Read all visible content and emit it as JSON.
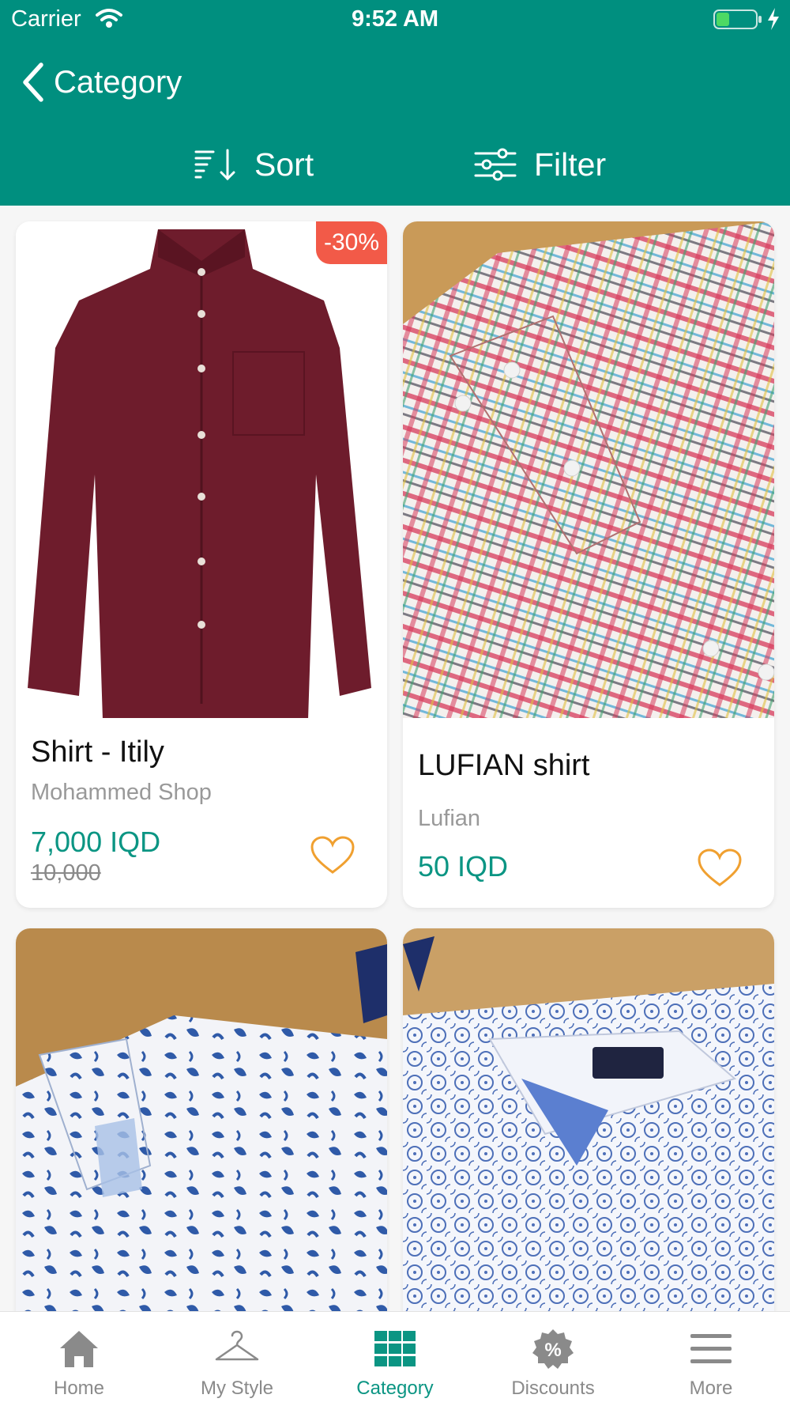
{
  "status_bar": {
    "carrier": "Carrier",
    "time": "9:52 AM"
  },
  "header": {
    "back_label": "Category",
    "sort_label": "Sort",
    "filter_label": "Filter"
  },
  "products": [
    {
      "title": "Shirt - Itily",
      "shop": "Mohammed Shop",
      "price": "7,000 IQD",
      "old_price": "10,000",
      "badge": "-30%"
    },
    {
      "title": "LUFIAN shirt",
      "shop": "Lufian",
      "price": "50 IQD"
    },
    {
      "title": "",
      "shop": "",
      "price": ""
    },
    {
      "title": "",
      "shop": "",
      "price": ""
    }
  ],
  "tabs": [
    {
      "label": "Home",
      "icon": "home-icon"
    },
    {
      "label": "My Style",
      "icon": "hanger-icon"
    },
    {
      "label": "Category",
      "icon": "grid-icon",
      "active": true
    },
    {
      "label": "Discounts",
      "icon": "discount-badge-icon"
    },
    {
      "label": "More",
      "icon": "menu-icon"
    }
  ],
  "colors": {
    "primary": "#008f7f",
    "accent_text": "#0b9583",
    "badge": "#f25a48",
    "heart": "#f0a030"
  }
}
